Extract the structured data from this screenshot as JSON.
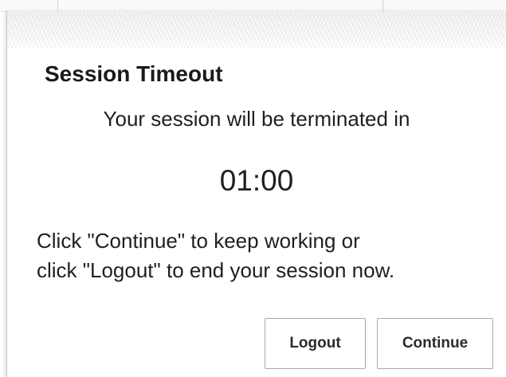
{
  "dialog": {
    "title": "Session Timeout",
    "message": "Your session will be terminated in",
    "countdown": "01:00",
    "instructions": [
      "Click \"Continue\" to keep working or",
      "click \"Logout\" to end your session now."
    ],
    "buttons": {
      "logout": "Logout",
      "continue": "Continue"
    }
  },
  "colors": {
    "text": "#1f1f1f",
    "button_border": "#a9a9a9",
    "dialog_border": "#c8c8c8"
  }
}
